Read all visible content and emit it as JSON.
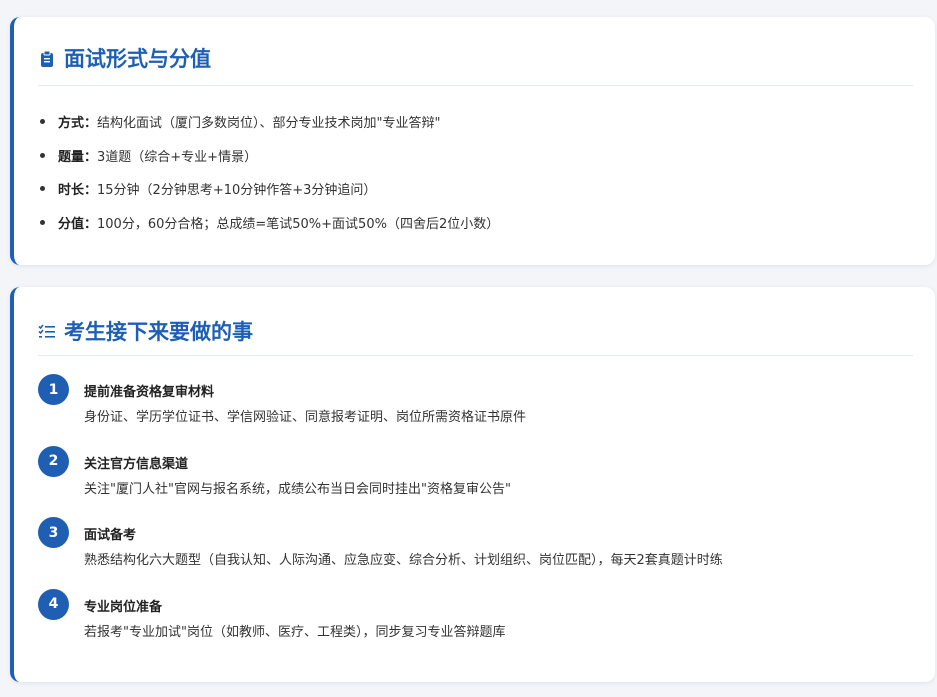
{
  "interview": {
    "title": "面试形式与分值",
    "items": [
      {
        "key": "方式：",
        "text": "结构化面试（厦门多数岗位）、部分专业技术岗加\"专业答辩\""
      },
      {
        "key": "题量：",
        "text": "3道题（综合+专业+情景）"
      },
      {
        "key": "时长：",
        "text": "15分钟（2分钟思考+10分钟作答+3分钟追问）"
      },
      {
        "key": "分值：",
        "text": "100分，60分合格；总成绩=笔试50%+面试50%（四舍后2位小数）"
      }
    ]
  },
  "todo": {
    "title": "考生接下来要做的事",
    "steps": [
      {
        "num": "1",
        "title": "提前准备资格复审材料",
        "desc": "身份证、学历学位证书、学信网验证、同意报考证明、岗位所需资格证书原件"
      },
      {
        "num": "2",
        "title": "关注官方信息渠道",
        "desc": "关注\"厦门人社\"官网与报名系统，成绩公布当日会同时挂出\"资格复审公告\""
      },
      {
        "num": "3",
        "title": "面试备考",
        "desc": "熟悉结构化六大题型（自我认知、人际沟通、应急应变、综合分析、计划组织、岗位匹配），每天2套真题计时练"
      },
      {
        "num": "4",
        "title": "专业岗位准备",
        "desc": "若报考\"专业加试\"岗位（如教师、医疗、工程类），同步复习专业答辩题库"
      }
    ]
  },
  "colors": {
    "accent": "#1f5fb3",
    "text": "#333333"
  },
  "icons": {
    "interview_title": "clipboard-icon",
    "todo_title": "checklist-icon"
  }
}
